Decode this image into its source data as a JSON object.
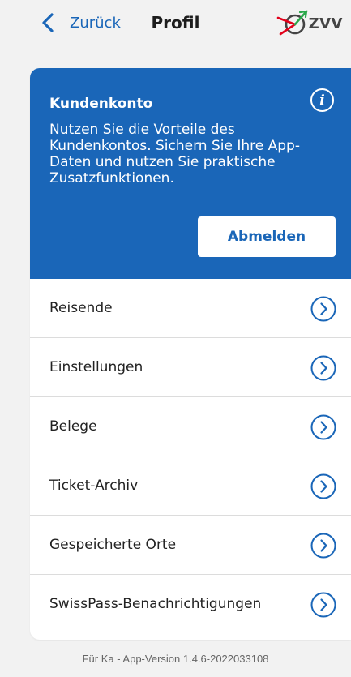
{
  "header": {
    "back_label": "Zurück",
    "title": "Profil",
    "logo_text": "ZVV"
  },
  "account": {
    "title": "Kundenkonto",
    "description": "Nutzen Sie die Vorteile des Kundenkontos. Sichern Sie Ihre App-Daten und nutzen Sie praktische Zusatzfunktionen.",
    "info_icon_glyph": "i",
    "logout_label": "Abmelden"
  },
  "menu": {
    "items": [
      {
        "label": "Reisende"
      },
      {
        "label": "Einstellungen"
      },
      {
        "label": "Belege"
      },
      {
        "label": "Ticket-Archiv"
      },
      {
        "label": "Gespeicherte Orte"
      },
      {
        "label": "SwissPass-Benachrichtigungen"
      }
    ]
  },
  "footer": {
    "text": "Für Ka - App-Version 1.4.6-2022033108"
  },
  "colors": {
    "accent": "#1a66b8",
    "background": "#f2f2f2",
    "card": "#ffffff"
  }
}
